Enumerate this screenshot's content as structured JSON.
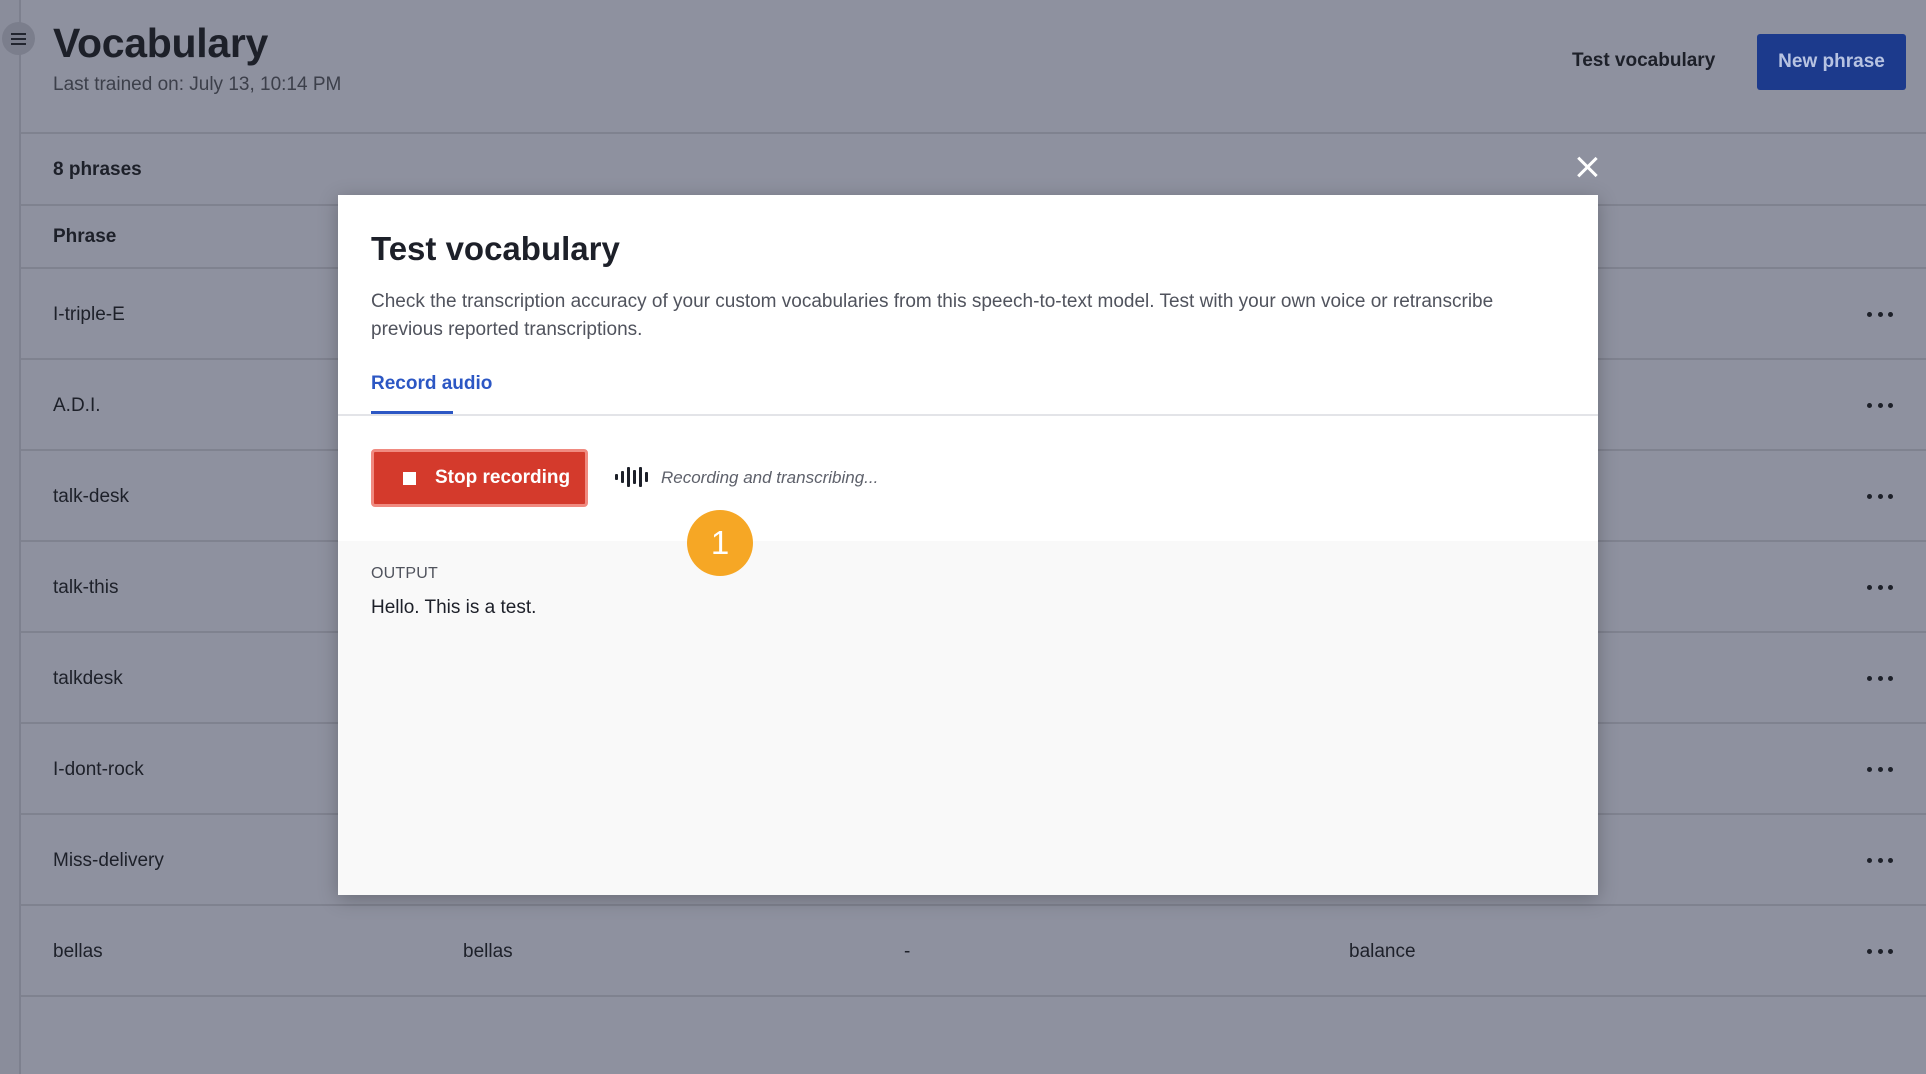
{
  "header": {
    "title": "Vocabulary",
    "subtitle": "Last trained on: July 13, 10:14 PM",
    "test_vocabulary_label": "Test vocabulary",
    "new_phrase_label": "New phrase"
  },
  "table": {
    "count_label": "8 phrases",
    "phrase_column_header": "Phrase",
    "rows": [
      {
        "phrase": "I-triple-E",
        "col2": "",
        "col3": "",
        "col4": ""
      },
      {
        "phrase": "A.D.I.",
        "col2": "",
        "col3": "",
        "col4": ""
      },
      {
        "phrase": "talk-desk",
        "col2": "",
        "col3": "",
        "col4": ""
      },
      {
        "phrase": "talk-this",
        "col2": "",
        "col3": "",
        "col4": ""
      },
      {
        "phrase": "talkdesk",
        "col2": "",
        "col3": "",
        "col4": ""
      },
      {
        "phrase": "I-dont-rock",
        "col2": "",
        "col3": "",
        "col4": ""
      },
      {
        "phrase": "Miss-delivery",
        "col2": "",
        "col3": "",
        "col4": ""
      },
      {
        "phrase": "bellas",
        "col2": "bellas",
        "col3": "-",
        "col4": "balance"
      }
    ]
  },
  "modal": {
    "title": "Test vocabulary",
    "description": "Check the transcription accuracy of your custom vocabularies from this speech-to-text model. Test with your own voice or retranscribe previous reported transcriptions.",
    "tab_label": "Record audio",
    "stop_button_label": "Stop recording",
    "status_text": "Recording and transcribing...",
    "output_label": "OUTPUT",
    "output_text": "Hello. This is a test."
  },
  "step_badge": "1",
  "icons": {
    "menu": "hamburger-menu-icon",
    "close": "close-icon",
    "more": "more-horizontal-icon",
    "stop": "stop-icon",
    "waveform": "audio-waveform-icon"
  },
  "colors": {
    "primary_button": "#1c3a8c",
    "accent_blue": "#2c57c4",
    "stop_red": "#d43a2c",
    "badge_orange": "#f6a725",
    "overlay": "#8e919f"
  }
}
